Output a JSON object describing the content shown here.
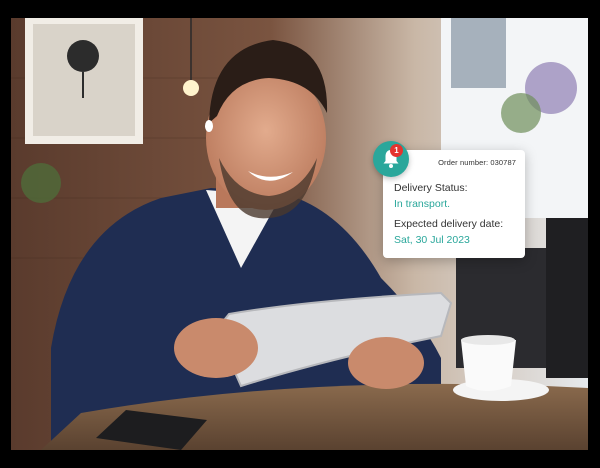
{
  "delivery_card": {
    "order_number": "Order number: 030787",
    "status_label": "Delivery Status:",
    "status_value": "In transport.",
    "date_label": "Expected delivery date:",
    "date_value": "Sat, 30 Jul 2023"
  },
  "notification": {
    "icon": "bell-icon",
    "count": "1"
  },
  "colors": {
    "accent": "#2aa79b",
    "badge": "#e3342f"
  }
}
